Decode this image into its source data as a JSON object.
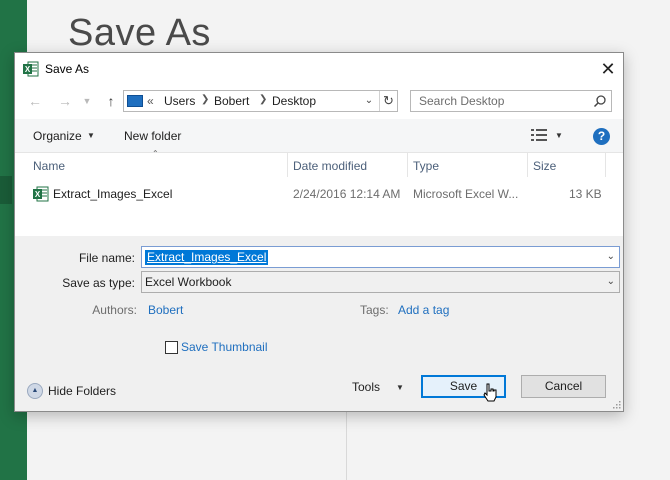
{
  "background": {
    "title": "Save As",
    "accent": "#217346"
  },
  "dialog": {
    "title": "Save As",
    "close_glyph": "✕"
  },
  "address": {
    "root_glyph": "«",
    "crumbs": [
      "Users",
      "Bobert",
      "Desktop"
    ],
    "search_placeholder": "Search Desktop"
  },
  "toolbar": {
    "organize_label": "Organize",
    "new_folder_label": "New folder",
    "help_glyph": "?"
  },
  "file_list": {
    "columns": [
      "Name",
      "Date modified",
      "Type",
      "Size"
    ],
    "files": [
      {
        "name": "Extract_Images_Excel",
        "date_modified": "2/24/2016 12:14 AM",
        "type": "Microsoft Excel W...",
        "size": "13 KB",
        "icon": "excel-file-icon"
      }
    ]
  },
  "form": {
    "file_name_label": "File name:",
    "file_name_value": "Extract_Images_Excel",
    "save_type_label": "Save as type:",
    "save_type_value": "Excel Workbook",
    "authors_label": "Authors:",
    "authors_value": "Bobert",
    "tags_label": "Tags:",
    "tags_value": "Add a tag",
    "thumbnail_label": "Save Thumbnail",
    "thumbnail_checked": false
  },
  "footer": {
    "hide_folders_label": "Hide Folders",
    "tools_label": "Tools",
    "save_label": "Save",
    "cancel_label": "Cancel"
  },
  "colors": {
    "excel_green": "#217346",
    "link_blue": "#1f6fbf",
    "selection_blue": "#0078d7"
  }
}
